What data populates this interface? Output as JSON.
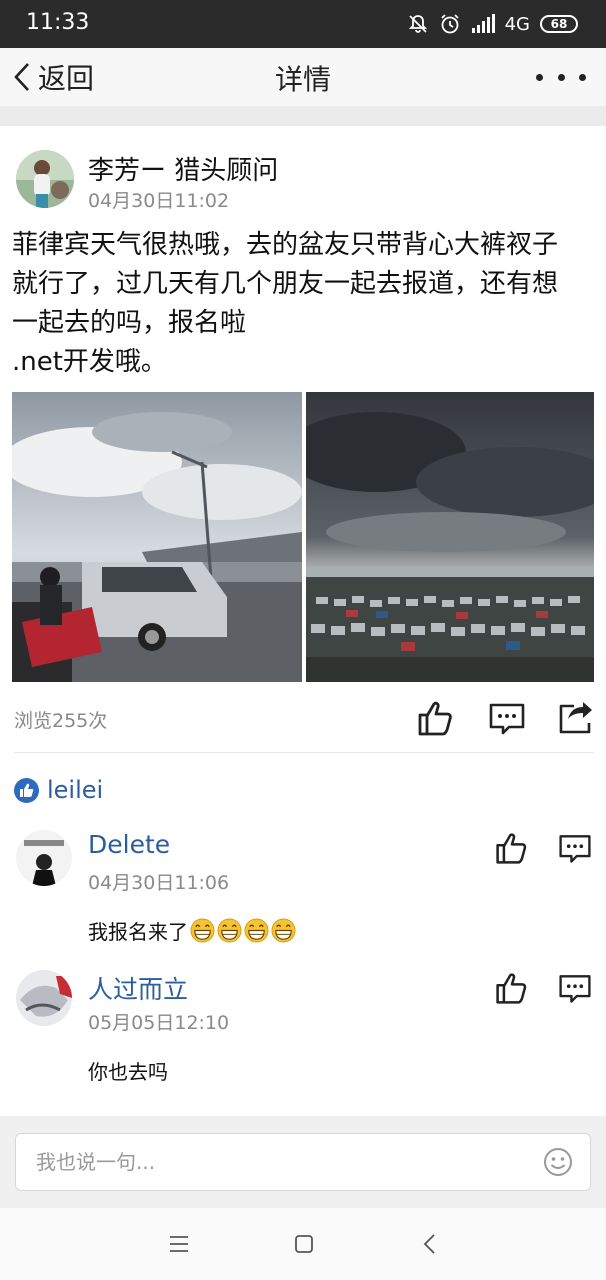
{
  "status_bar": {
    "time": "11:33",
    "network": "4G",
    "battery": "68"
  },
  "nav": {
    "back_label": "返回",
    "title": "详情"
  },
  "post": {
    "author": "李芳ー 猎头顾问",
    "time": "04月30日11:02",
    "body_lines": [
      "菲律宾天气很热哦，去的盆友只带背心大裤衩子",
      "就行了，过几天有几个朋友一起去报道，还有想",
      "一起去的吗，报名啦",
      ".net开发哦。"
    ],
    "views": "浏览255次"
  },
  "likes": {
    "names": "leilei"
  },
  "comments": [
    {
      "name": "Delete",
      "time": "04月30日11:06",
      "text": "我报名来了",
      "emoji_count": 4
    },
    {
      "name": "人过而立",
      "time": "05月05日12:10",
      "text": "你也去吗",
      "emoji_count": 0
    }
  ],
  "comment_input": {
    "placeholder": "我也说一句..."
  },
  "colors": {
    "link_blue": "#2c5e9e",
    "like_badge": "#2c6bbf",
    "status_bar_bg": "#2b2b2b"
  }
}
